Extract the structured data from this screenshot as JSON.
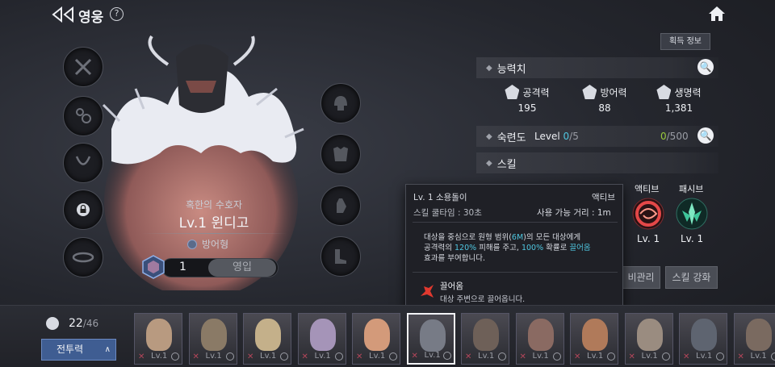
{
  "header": {
    "title": "영웅",
    "help": "?"
  },
  "hero": {
    "subtitle": "혹한의 수호자",
    "name": "Lv.1 윈디고",
    "role": "방어형",
    "count": "1",
    "enlist_label": "영입"
  },
  "info_button": "획득 정보",
  "stats_section": {
    "title": "능력치",
    "stats": [
      {
        "label": "공격력",
        "value": "195"
      },
      {
        "label": "방어력",
        "value": "88"
      },
      {
        "label": "생명력",
        "value": "1,381"
      }
    ]
  },
  "mastery": {
    "title": "숙련도",
    "level_label": "Level",
    "level_cur": "0",
    "level_max": "/5",
    "exp_cur": "0",
    "exp_max": "/500"
  },
  "skill_section": {
    "title": "스킬",
    "active_label": "액티브",
    "passive_label": "패시브",
    "active_lv": "Lv. 1",
    "passive_lv": "Lv. 1",
    "manage_button": "비관리",
    "enhance_button": "스킬 강화"
  },
  "tooltip": {
    "title": "Lv. 1 소용돌이",
    "type": "액티브",
    "cooldown": "스킬 쿨타임 : 30초",
    "range": "사용 가능 거리 : 1m",
    "desc_line1_a": "대상을 중심으로 원형 범위(",
    "desc_line1_b": "6M",
    "desc_line1_c": ")의 모든 대상에게",
    "desc_line2_a": "공격력의 ",
    "desc_line2_b": "120%",
    "desc_line2_c": " 피해를 주고, ",
    "desc_line2_d": "100%",
    "desc_line2_e": " 확률로 ",
    "desc_line2_f": "끌어옴",
    "desc_line3": "효과를 부여합니다.",
    "effect_title": "끌어옴",
    "effect_desc": "대상 주변으로 끌어옵니다."
  },
  "roster": {
    "count_cur": "22",
    "count_max": "/46",
    "sort_label": "전투력",
    "cards": [
      {
        "lv": "Lv.1",
        "color": "#b89a80"
      },
      {
        "lv": "Lv.1",
        "color": "#8a7a66"
      },
      {
        "lv": "Lv.1",
        "color": "#c4b08a"
      },
      {
        "lv": "Lv.1",
        "color": "#a594b8"
      },
      {
        "lv": "Lv.1",
        "color": "#d39a7a"
      },
      {
        "lv": "Lv.1",
        "color": "#777b86"
      },
      {
        "lv": "Lv.1",
        "color": "#6e6058"
      },
      {
        "lv": "Lv.1",
        "color": "#8a6a62"
      },
      {
        "lv": "Lv.1",
        "color": "#b07a5a"
      },
      {
        "lv": "Lv.1",
        "color": "#9a8c80"
      },
      {
        "lv": "Lv.1",
        "color": "#5e6470"
      },
      {
        "lv": "Lv.1",
        "color": "#7a6a60"
      }
    ]
  }
}
